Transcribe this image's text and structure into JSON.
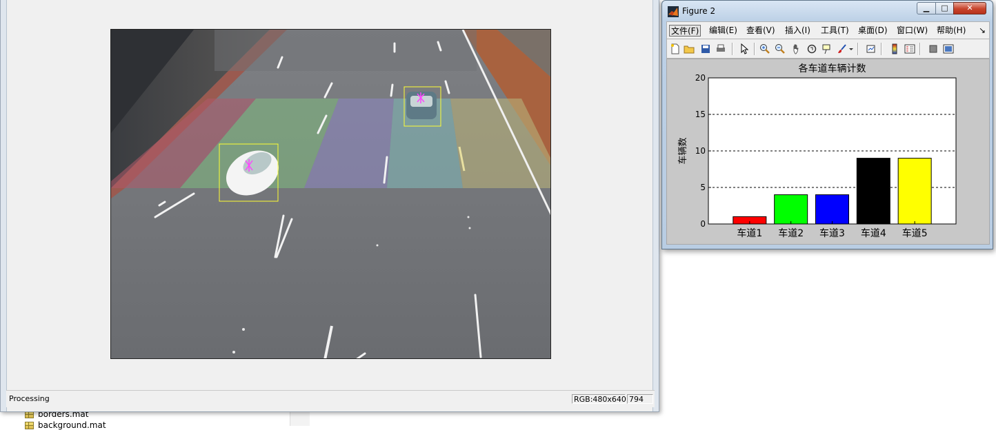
{
  "file_browser": {
    "items": [
      {
        "name": "borders.mat"
      },
      {
        "name": "background.mat"
      }
    ]
  },
  "video_window": {
    "status": "Processing",
    "rgb_info": "RGB:480x640",
    "frame": "794"
  },
  "figure_window": {
    "title": "Figure 2",
    "buttons": {
      "minimize": "▁",
      "maximize": "□",
      "close": "✕"
    },
    "menu": [
      {
        "label": "文件(F)",
        "active": true
      },
      {
        "label": "编辑(E)",
        "active": false
      },
      {
        "label": "查看(V)",
        "active": false
      },
      {
        "label": "插入(I)",
        "active": false
      },
      {
        "label": "工具(T)",
        "active": false
      },
      {
        "label": "桌面(D)",
        "active": false
      },
      {
        "label": "窗口(W)",
        "active": false
      },
      {
        "label": "帮助(H)",
        "active": false
      }
    ],
    "menu_overflow": "↘",
    "toolbar_icons": [
      "new-figure-icon",
      "open-file-icon",
      "save-icon",
      "print-icon",
      "select-arrow-icon",
      "zoom-in-icon",
      "zoom-out-icon",
      "pan-hand-icon",
      "rotate-3d-icon",
      "data-cursor-icon",
      "brush-icon",
      "brush-dropdown-icon",
      "link-plot-icon",
      "colorbar-icon",
      "legend-icon",
      "hide-plot-tools-icon",
      "show-plot-tools-icon"
    ]
  },
  "chart_data": {
    "type": "bar",
    "title": "各车道车辆计数",
    "xlabel": "",
    "ylabel": "车辆数",
    "categories": [
      "车道1",
      "车道2",
      "车道3",
      "车道4",
      "车道5"
    ],
    "values": [
      1,
      4,
      4,
      9,
      9
    ],
    "colors": [
      "#ff0000",
      "#00ff00",
      "#0000ff",
      "#000000",
      "#ffff00"
    ],
    "ylim": [
      0,
      20
    ],
    "yticks": [
      0,
      5,
      10,
      15,
      20
    ],
    "grid": "y-dashed",
    "legend": "none"
  }
}
